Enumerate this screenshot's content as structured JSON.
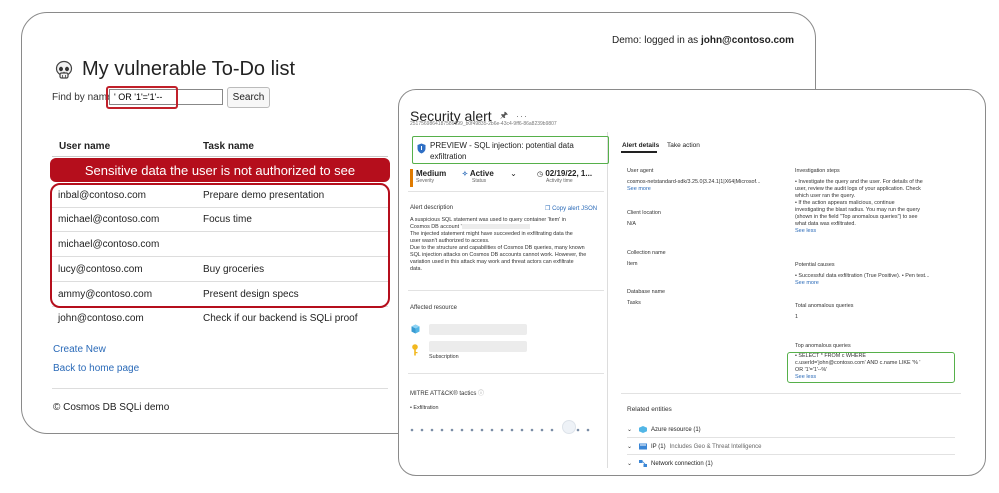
{
  "todo_app": {
    "login_prefix": "Demo: logged in as ",
    "login_user": "john@contoso.com",
    "title": "My vulnerable To-Do list",
    "find_label": "Find by name",
    "search_value": "' OR '1'='1'--",
    "search_button": "Search",
    "columns": [
      "User name",
      "Task name"
    ],
    "warning_banner": "Sensitive data the user is not authorized to see",
    "rows": [
      {
        "user": "inbal@contoso.com",
        "task": "Prepare demo presentation"
      },
      {
        "user": "michael@contoso.com",
        "task": "Focus time"
      },
      {
        "user": "michael@contoso.com",
        "task": ""
      },
      {
        "user": "lucy@contoso.com",
        "task": "Buy groceries"
      },
      {
        "user": "ammy@contoso.com",
        "task": "Present design specs"
      },
      {
        "user": "john@contoso.com",
        "task": "Check if our backend is SQLi proof"
      }
    ],
    "links": {
      "create": "Create New",
      "home": "Back to home page"
    },
    "footer": "© Cosmos DB SQLi demo"
  },
  "security_alert": {
    "title": "Security alert",
    "id": "2517569864187589999_b0f49835-2b6e-43c4-9ff6-86a8239b9807",
    "alert_name": "PREVIEW - SQL injection: potential data exfiltration",
    "severity": {
      "value": "Medium",
      "label": "Severity"
    },
    "status": {
      "value": "Active",
      "label": "Status"
    },
    "activity": {
      "value": "02/19/22, 1...",
      "label": "Activity time"
    },
    "description_heading": "Alert description",
    "copy_json": "Copy alert JSON",
    "description": [
      "A suspicious SQL statement was used to query container 'Item' in",
      "Cosmos DB account '",
      "The injected statement might have succeeded in exfiltrating data the",
      "user wasn't authorized to access.",
      "Due to the structure and capabilities of Cosmos DB queries, many known",
      "SQL injection attacks on Cosmos DB accounts cannot work. However, the",
      "variation used in this attack may work and threat actors can exfiltrate",
      "data."
    ],
    "affected_resource": "Affected resource",
    "subscription_label": "Subscription",
    "mitre_heading": "MITRE ATT&CK® tactics",
    "mitre_item": "Exfiltration",
    "tabs": [
      "Alert details",
      "Take action"
    ],
    "details": {
      "user_agent_label": "User agent",
      "user_agent_value": "cosmos-netstandard-sdk/3.25.0|3.24.1|1|X64|Microsof...",
      "see_more": "See more",
      "client_location_label": "Client location",
      "client_location_value": "N/A",
      "collection_label": "Collection name",
      "collection_value": "Item",
      "database_label": "Database name",
      "database_value": "Tasks"
    },
    "investigation": {
      "label": "Investigation steps",
      "lines": [
        "• Investigate the query and the user. For details of the",
        "user, review the audit logs of your application. Check",
        "which user ran the query.",
        "• If the action appears malicious, continue",
        "investigating the blast radius. You may run the query",
        "(shown in the field \"Top anomalous queries\") to see",
        "what data was exfiltrated."
      ],
      "see_less": "See less"
    },
    "causes": {
      "label": "Potential causes",
      "text": "• Successful data exfiltration (True Positive). • Pen test...",
      "see_more": "See more"
    },
    "total_queries": {
      "label": "Total anomalous queries",
      "value": "1"
    },
    "top_queries": {
      "label": "Top anomalous queries",
      "lines": [
        "• SELECT * FROM c WHERE",
        "c.userId='john@contoso.com' AND c.name LIKE '% '",
        "OR '1'='1'--%'"
      ],
      "see_less": "See less"
    },
    "related": {
      "label": "Related entities",
      "items": [
        {
          "name": "Azure resource (1)",
          "extra": ""
        },
        {
          "name": "IP (1)",
          "extra": "Includes Geo & Threat Intelligence"
        },
        {
          "name": "Network connection (1)",
          "extra": ""
        }
      ]
    }
  }
}
